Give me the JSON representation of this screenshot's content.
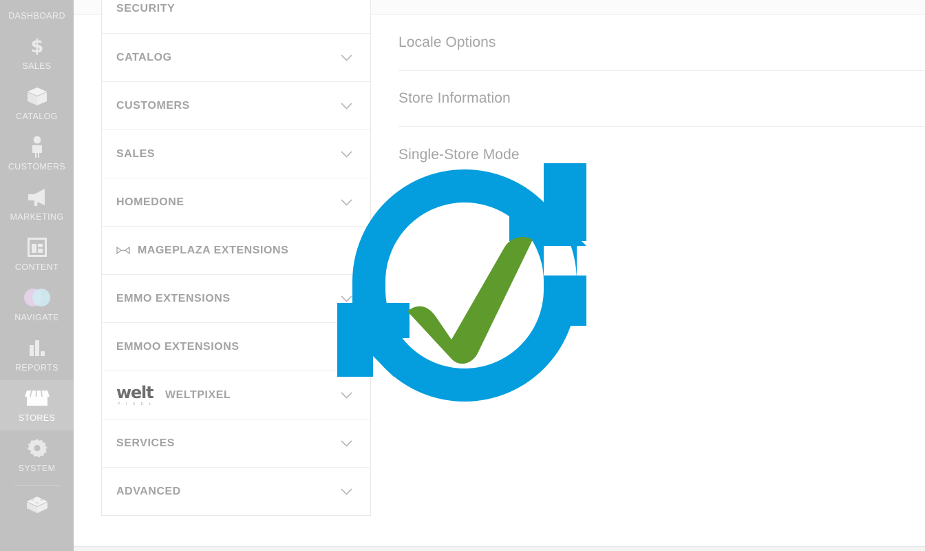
{
  "colors": {
    "sidebar_bg": "#aaaaaa",
    "sidebar_active_bg": "#b4b4b4",
    "panel_bg": "#ffffff",
    "label_gray": "#a3a3a3",
    "spinner_blue": "#049DDE",
    "spinner_green": "#5F9A2C",
    "navigate_pink": "#d9bfe0",
    "navigate_cyan": "#bfe4ee"
  },
  "sidebar": {
    "items": [
      {
        "label": "DASHBOARD",
        "icon": "dashboard-icon",
        "active": false,
        "partial_top": true
      },
      {
        "label": "SALES",
        "icon": "dollar-icon",
        "active": false
      },
      {
        "label": "CATALOG",
        "icon": "box-icon",
        "active": false
      },
      {
        "label": "CUSTOMERS",
        "icon": "person-icon",
        "active": false
      },
      {
        "label": "MARKETING",
        "icon": "megaphone-icon",
        "active": false
      },
      {
        "label": "CONTENT",
        "icon": "layout-icon",
        "active": false
      },
      {
        "label": "NAVIGATE",
        "icon": "venn-circles-icon",
        "active": false
      },
      {
        "label": "REPORTS",
        "icon": "bar-chart-icon",
        "active": false
      },
      {
        "label": "STORES",
        "icon": "storefront-icon",
        "active": true
      },
      {
        "label": "SYSTEM",
        "icon": "gear-icon",
        "active": false
      },
      {
        "label": "",
        "icon": "extensions-block-icon",
        "active": false,
        "partial_bottom": true
      }
    ]
  },
  "section_list": {
    "items": [
      {
        "label": "SECURITY",
        "logo": null,
        "chevron": false,
        "clipped": true
      },
      {
        "label": "CATALOG",
        "logo": null,
        "chevron": true
      },
      {
        "label": "CUSTOMERS",
        "logo": null,
        "chevron": true
      },
      {
        "label": "SALES",
        "logo": null,
        "chevron": true
      },
      {
        "label": "HOMEDONE",
        "logo": null,
        "chevron": true
      },
      {
        "label": "MAGEPLAZA EXTENSIONS",
        "logo": "mageplaza-logo",
        "chevron": false
      },
      {
        "label": "EMMO EXTENSIONS",
        "logo": null,
        "chevron": true
      },
      {
        "label": "EMMOO EXTENSIONS",
        "logo": null,
        "chevron": false
      },
      {
        "label": "WELTPIXEL",
        "logo": "weltpixel-logo",
        "chevron": true
      },
      {
        "label": "SERVICES",
        "logo": null,
        "chevron": true
      },
      {
        "label": "ADVANCED",
        "logo": null,
        "chevron": true
      }
    ]
  },
  "weltpixel_logo": {
    "word": "welt",
    "sub": "P I X E L"
  },
  "content": {
    "rows": [
      {
        "label": "Locale Options"
      },
      {
        "label": "Store Information"
      },
      {
        "label": "Single-Store Mode"
      }
    ]
  },
  "loading_overlay": {
    "icon": "refresh-check-spinner-icon",
    "visible": true
  }
}
